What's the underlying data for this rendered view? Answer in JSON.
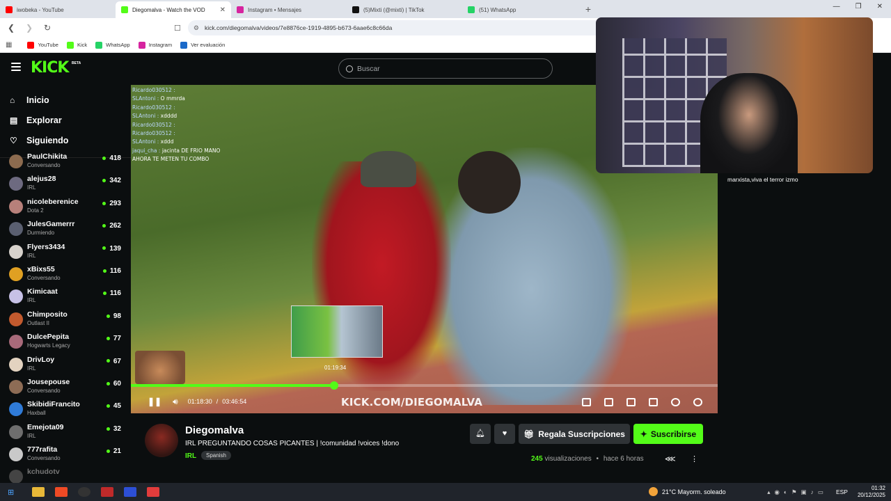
{
  "browser": {
    "tabs": [
      {
        "label": "iwobeka - YouTube",
        "color": "#ff0000"
      },
      {
        "label": "Diegomalva - Watch the VOD",
        "color": "#53fc18"
      },
      {
        "label": "Instagram • Mensajes",
        "color": "#d6249f"
      },
      {
        "label": "(5)Mixti (@mixti) | TikTok",
        "color": "#111111"
      },
      {
        "label": "(51) WhatsApp",
        "color": "#25d366"
      }
    ],
    "new_tab": "+",
    "url": "kick.com/diegomalva/videos/7e8876ce-1919-4895-b673-6aae6c8c66da",
    "bookmarks": [
      {
        "label": "YouTube",
        "color": "#ff0000"
      },
      {
        "label": "Kick",
        "color": "#53fc18"
      },
      {
        "label": "WhatsApp",
        "color": "#25d366"
      },
      {
        "label": "Instagram",
        "color": "#d6249f"
      },
      {
        "label": "Ver evaluación",
        "color": "#1b6ac9"
      }
    ]
  },
  "header": {
    "logo": "KICK",
    "beta": "BETA",
    "search_placeholder": "Buscar"
  },
  "sidebar": {
    "nav": [
      {
        "label": "Inicio",
        "icon": "home-icon"
      },
      {
        "label": "Explorar",
        "icon": "explore-icon"
      },
      {
        "label": "Siguiendo",
        "icon": "heart-icon"
      }
    ],
    "following": [
      {
        "name": "PaulChikita",
        "category": "Conversando",
        "viewers": "418",
        "color": "#8c6b4f"
      },
      {
        "name": "alejus28",
        "category": "IRL",
        "viewers": "342",
        "color": "#6d6a80"
      },
      {
        "name": "nicoleberenice",
        "category": "Dota 2",
        "viewers": "293",
        "color": "#b7807a"
      },
      {
        "name": "JulesGamerrr",
        "category": "Durmiendo",
        "viewers": "262",
        "color": "#5a5f70"
      },
      {
        "name": "Flyers3434",
        "category": "IRL",
        "viewers": "139",
        "color": "#d7d2cc"
      },
      {
        "name": "xBixs55",
        "category": "Conversando",
        "viewers": "116",
        "color": "#e0a022"
      },
      {
        "name": "Kimicaat",
        "category": "IRL",
        "viewers": "116",
        "color": "#c7c1e6"
      },
      {
        "name": "Chimposito",
        "category": "Outlast II",
        "viewers": "98",
        "color": "#c25a2e"
      },
      {
        "name": "DulcePepita",
        "category": "Hogwarts Legacy",
        "viewers": "77",
        "color": "#a86a7a"
      },
      {
        "name": "DrivLoy",
        "category": "IRL",
        "viewers": "67",
        "color": "#e3d3c0"
      },
      {
        "name": "Jousepouse",
        "category": "Conversando",
        "viewers": "60",
        "color": "#8d6c55"
      },
      {
        "name": "SkibidiFrancito",
        "category": "Haxball",
        "viewers": "45",
        "color": "#2f7bd8"
      },
      {
        "name": "Emejota09",
        "category": "IRL",
        "viewers": "32",
        "color": "#6e6e6e"
      },
      {
        "name": "777rafita",
        "category": "Conversando",
        "viewers": "21",
        "color": "#c9c9c9"
      },
      {
        "name": "kchudotv",
        "category": "",
        "viewers": "",
        "color": "#444444"
      }
    ]
  },
  "player": {
    "chat": [
      {
        "user": "Ricardo030512 :",
        "msg": ""
      },
      {
        "user": "SLAntoni :",
        "msg": "O mmrda"
      },
      {
        "user": "Ricardo030512 :",
        "msg": ""
      },
      {
        "user": "SLAntoni :",
        "msg": "xdddd"
      },
      {
        "user": "Ricardo030512 :",
        "msg": ""
      },
      {
        "user": "Ricardo030512 :",
        "msg": ""
      },
      {
        "user": "SLAntoni :",
        "msg": "xddd"
      },
      {
        "user": "jaqui_cha :",
        "msg": "jacinta DE FRIO MANO"
      },
      {
        "user": "",
        "msg": "AHORA TE METEN TU COMBO"
      }
    ],
    "preview_time": "01:19:34",
    "current_time": "01:18:30",
    "separator": "/",
    "duration": "03:46:54",
    "progress": 0.346,
    "watermark": "KICK.COM/DIEGOMALVA"
  },
  "webcam_caption": "marxista,viva el terror izmo",
  "channel": {
    "name": "Diegomalva",
    "title": "IRL PREGUNTANDO COSAS PICANTES | !comunidad !voices !dono",
    "category": "IRL",
    "tag": "Spanish",
    "gift_label": "Regala Suscripciones",
    "subscribe_label": "Suscribirse",
    "views": "245",
    "views_label": "visualizaciones",
    "bullet": "•",
    "ago": "hace 6 horas"
  },
  "taskbar": {
    "weather": "21°C  Mayorm. soleado",
    "lang": "ESP",
    "time": "01:32",
    "date": "20/12/2025"
  }
}
